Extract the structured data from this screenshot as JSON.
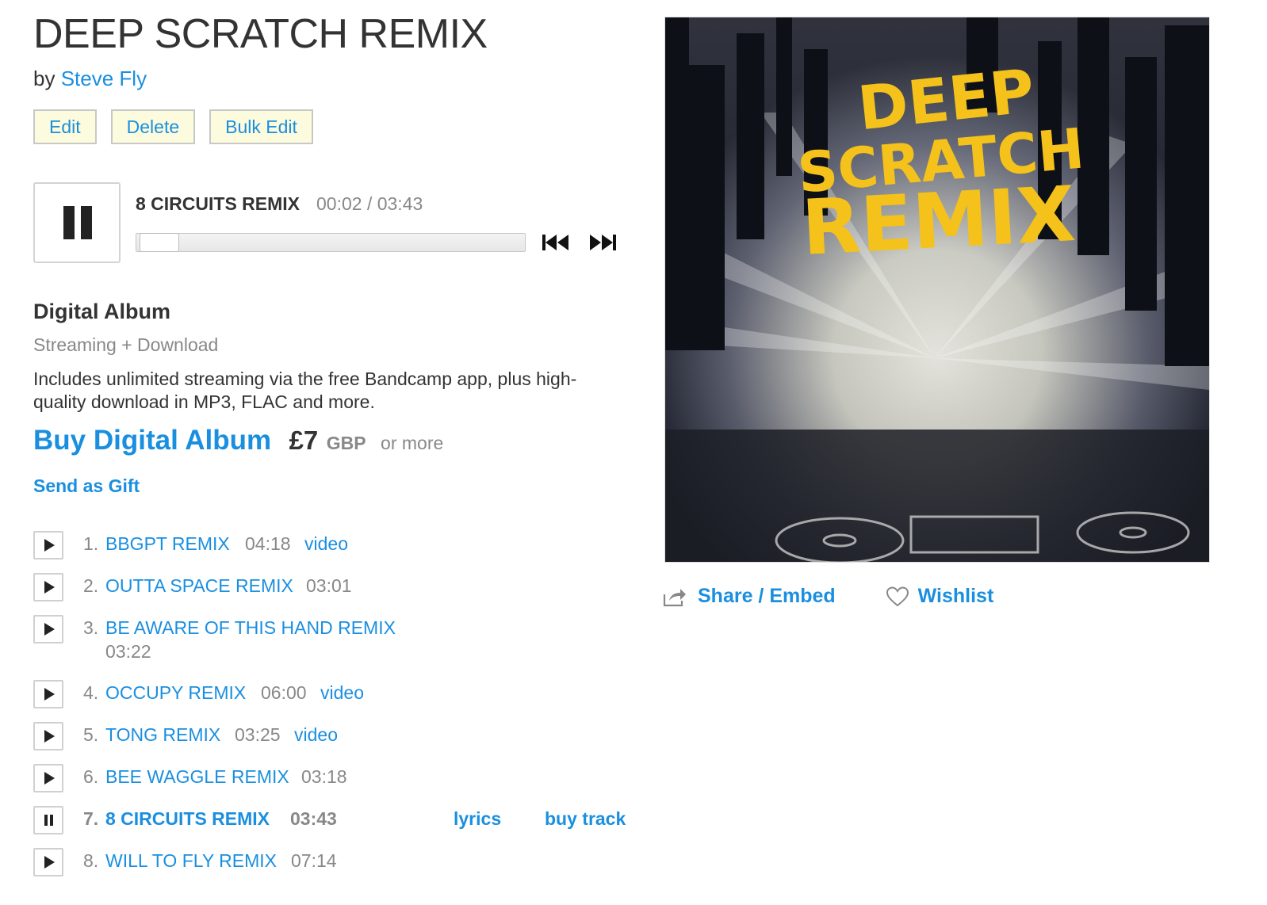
{
  "album": {
    "title": "DEEP SCRATCH REMIX",
    "by_prefix": "by",
    "artist": "Steve Fly"
  },
  "admin": {
    "edit": "Edit",
    "delete": "Delete",
    "bulk_edit": "Bulk Edit"
  },
  "player": {
    "state": "playing",
    "track_title": "8 CIRCUITS REMIX",
    "time": "00:02 / 03:43",
    "progress_fraction": 0.01
  },
  "purchase": {
    "heading": "Digital Album",
    "subheading": "Streaming + Download",
    "description": "Includes unlimited streaming via the free Bandcamp app, plus high-quality download in MP3, FLAC and more.",
    "buy_label": "Buy Digital Album",
    "price": "£7",
    "currency": "GBP",
    "or_more": "or more",
    "gift_label": "Send as Gift"
  },
  "tracks": [
    {
      "num": "1.",
      "title": "BBGPT REMIX",
      "duration": "04:18",
      "video": "video"
    },
    {
      "num": "2.",
      "title": "OUTTA SPACE REMIX",
      "duration": "03:01"
    },
    {
      "num": "3.",
      "title": "BE AWARE OF THIS HAND REMIX",
      "duration": "03:22"
    },
    {
      "num": "4.",
      "title": "OCCUPY REMIX",
      "duration": "06:00",
      "video": "video"
    },
    {
      "num": "5.",
      "title": "TONG REMIX",
      "duration": "03:25",
      "video": "video"
    },
    {
      "num": "6.",
      "title": "BEE WAGGLE REMIX",
      "duration": "03:18"
    },
    {
      "num": "7.",
      "title": "8 CIRCUITS REMIX",
      "duration": "03:43",
      "lyrics": "lyrics",
      "buy": "buy track",
      "playing": true
    },
    {
      "num": "8.",
      "title": "WILL TO FLY REMIX",
      "duration": "07:14"
    }
  ],
  "artwork": {
    "lines": [
      "DEEP",
      "SCRATCH",
      "REMIX"
    ],
    "text_color": "#f4c21b"
  },
  "actions": {
    "share": "Share / Embed",
    "wishlist": "Wishlist"
  },
  "colors": {
    "link": "#1a8fe0",
    "admin_button_bg": "#fdfbdd"
  }
}
